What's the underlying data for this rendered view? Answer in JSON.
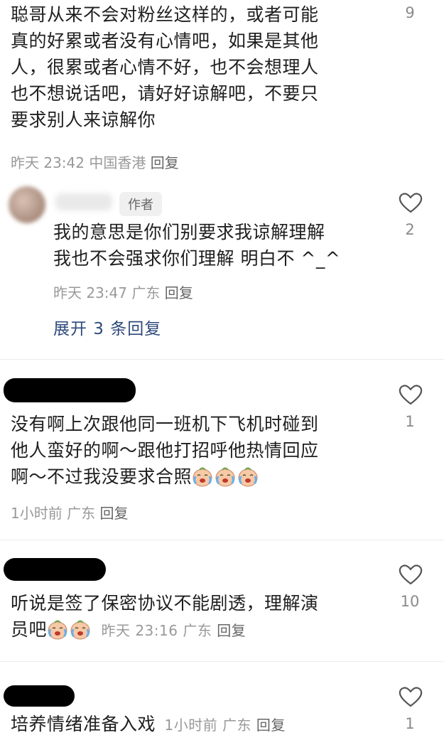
{
  "comments": [
    {
      "text": "聪哥从来不会对粉丝这样的，或者可能真的好累或者没有心情吧，如果是其他人，很累或者心情不好，也不会想理人也不想说话吧，请好好谅解吧，不要只要求别人来谅解你",
      "lines": [
        "聪哥从来不会对粉丝这样的，或者可能",
        "真的好累或者没有心情吧，如果是其他",
        "人，很累或者心情不好，也不会想理人",
        "也不想说话吧，请好好谅解吧，不要只",
        "要求别人来谅解你"
      ],
      "time": "昨天 23:42",
      "location": "中国香港",
      "reply": "回复",
      "likes": "9"
    },
    {
      "badge": "作者",
      "lines": [
        "我的意思是你们别要求我谅解理解",
        "我也不会强求你们理解 明白不 ^_^"
      ],
      "time": "昨天 23:47",
      "location": "广东",
      "reply": "回复",
      "likes": "2",
      "expand": "展开 3 条回复"
    },
    {
      "lines": [
        "没有啊上次跟他同一班机下飞机时碰到",
        "他人蛮好的啊～跟他打招呼他热情回应",
        "啊～不过我没要求合照"
      ],
      "time": "1小时前",
      "location": "广东",
      "reply": "回复",
      "likes": "1",
      "emoji": "crying-laughing"
    },
    {
      "lines": [
        "听说是签了保密协议不能剧透，理解演",
        "员吧"
      ],
      "time": "昨天 23:16",
      "location": "广东",
      "reply": "回复",
      "likes": "10",
      "emoji": "crying-laughing"
    },
    {
      "lines": [
        "培养情绪准备入戏"
      ],
      "time": "1小时前",
      "location": "广东",
      "reply": "回复",
      "likes": "1"
    }
  ],
  "colors": {
    "text": "#1f1f1f",
    "meta": "#999999",
    "link": "#2f4a7a",
    "divider": "#ececec"
  }
}
